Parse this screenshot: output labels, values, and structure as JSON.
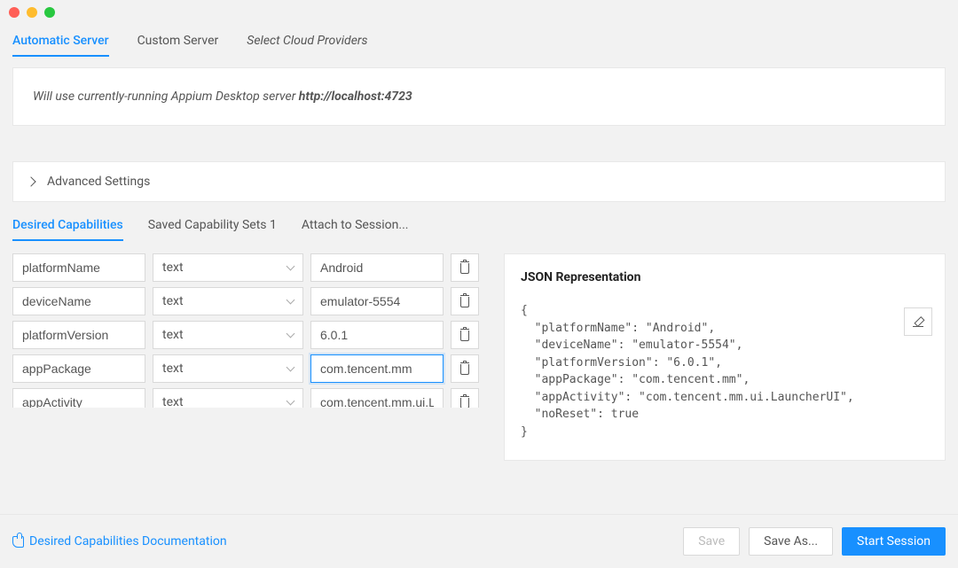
{
  "tabs": {
    "automatic": "Automatic Server",
    "custom": "Custom Server",
    "cloud": "Select Cloud Providers"
  },
  "info": {
    "prefix": "Will use currently-running Appium Desktop server ",
    "url": "http://localhost:4723"
  },
  "advanced": {
    "label": "Advanced Settings"
  },
  "subtabs": {
    "desired": "Desired Capabilities",
    "saved": "Saved Capability Sets 1",
    "attach": "Attach to Session..."
  },
  "caps": [
    {
      "name": "platformName",
      "type": "text",
      "value": "Android"
    },
    {
      "name": "deviceName",
      "type": "text",
      "value": "emulator-5554"
    },
    {
      "name": "platformVersion",
      "type": "text",
      "value": "6.0.1"
    },
    {
      "name": "appPackage",
      "type": "text",
      "value": "com.tencent.mm",
      "focused": true
    },
    {
      "name": "appActivity",
      "type": "text",
      "value": "com.tencent.mm.ui.LauncherUI",
      "cut": true
    }
  ],
  "json": {
    "title": "JSON Representation",
    "body": "{\n  \"platformName\": \"Android\",\n  \"deviceName\": \"emulator-5554\",\n  \"platformVersion\": \"6.0.1\",\n  \"appPackage\": \"com.tencent.mm\",\n  \"appActivity\": \"com.tencent.mm.ui.LauncherUI\",\n  \"noReset\": true\n}"
  },
  "footer": {
    "doc": "Desired Capabilities Documentation",
    "save": "Save",
    "saveas": "Save As...",
    "start": "Start Session"
  }
}
